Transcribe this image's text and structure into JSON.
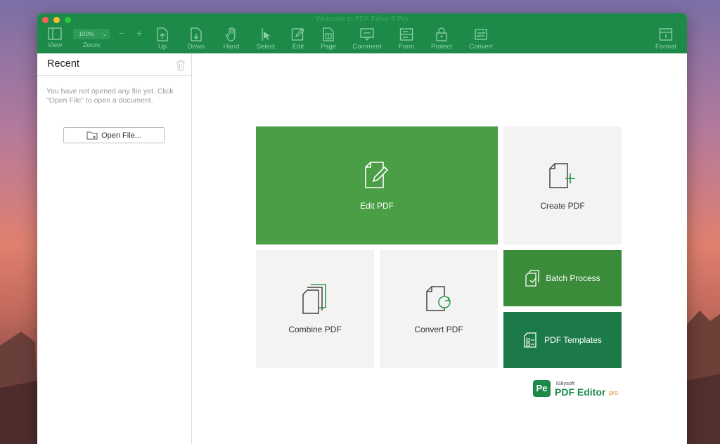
{
  "window": {
    "title": "Welcome to PDF Editor 6 Pro"
  },
  "toolbar": {
    "zoom_value": "100%",
    "zoom_minus": "−",
    "zoom_plus": "+",
    "items": [
      {
        "label": "View",
        "icon": "sidebar-view-icon"
      },
      {
        "label": "Zoom",
        "icon": "zoom-select"
      },
      {
        "label": "Up",
        "icon": "page-up-icon"
      },
      {
        "label": "Down",
        "icon": "page-down-icon"
      },
      {
        "label": "Hand",
        "icon": "hand-icon"
      },
      {
        "label": "Select",
        "icon": "cursor-icon"
      },
      {
        "label": "Edit",
        "icon": "edit-icon"
      },
      {
        "label": "Page",
        "icon": "page-icon"
      },
      {
        "label": "Comment",
        "icon": "comment-icon"
      },
      {
        "label": "Form",
        "icon": "form-icon"
      },
      {
        "label": "Protect",
        "icon": "lock-icon"
      },
      {
        "label": "Convert",
        "icon": "convert-icon"
      },
      {
        "label": "Format",
        "icon": "info-icon"
      }
    ]
  },
  "sidebar": {
    "title": "Recent",
    "empty_message": "You have not opened any file yet. Click \"Open File\" to open a document.",
    "open_button": "Open File..."
  },
  "tiles": {
    "edit": "Edit PDF",
    "create": "Create PDF",
    "combine": "Combine PDF",
    "convert": "Convert PDF",
    "batch": "Batch Process",
    "templates": "PDF Templates"
  },
  "brand": {
    "badge": "Pe",
    "maker": "iSkysoft",
    "name": "PDF Editor",
    "edition": "pro"
  },
  "colors": {
    "brand_green": "#1e8a4a",
    "edit_tile": "#4a9e45",
    "batch_tile": "#3a8c3b",
    "templates_tile": "#1b7a48",
    "light_tile": "#f3f3f3"
  }
}
